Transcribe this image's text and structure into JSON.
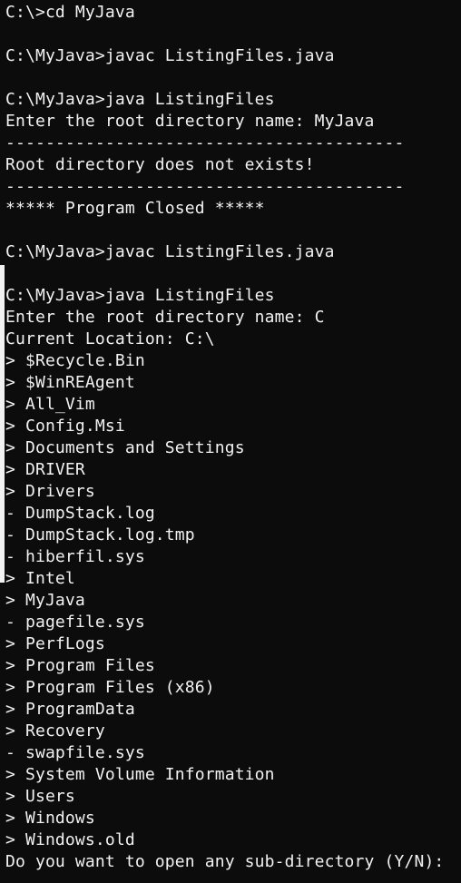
{
  "terminal": {
    "lines": [
      "C:\\>cd MyJava",
      "",
      "C:\\MyJava>javac ListingFiles.java",
      "",
      "C:\\MyJava>java ListingFiles",
      "Enter the root directory name: MyJava",
      "----------------------------------------",
      "Root directory does not exists!",
      "----------------------------------------",
      "***** Program Closed *****",
      "",
      "C:\\MyJava>javac ListingFiles.java",
      "",
      "C:\\MyJava>java ListingFiles",
      "Enter the root directory name: C",
      "Current Location: C:\\",
      "> $Recycle.Bin",
      "> $WinREAgent",
      "> All_Vim",
      "> Config.Msi",
      "> Documents and Settings",
      "> DRIVER",
      "> Drivers",
      "- DumpStack.log",
      "- DumpStack.log.tmp",
      "- hiberfil.sys",
      "> Intel",
      "> MyJava",
      "- pagefile.sys",
      "> PerfLogs",
      "> Program Files",
      "> Program Files (x86)",
      "> ProgramData",
      "> Recovery",
      "- swapfile.sys",
      "> System Volume Information",
      "> Users",
      "> Windows",
      "> Windows.old",
      "Do you want to open any sub-directory (Y/N): "
    ]
  }
}
